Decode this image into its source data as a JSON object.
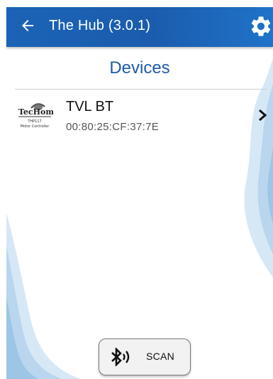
{
  "app_bar": {
    "title": "The Hub (3.0.1)",
    "back_icon": "arrow-left",
    "settings_icon": "gear",
    "color": "#1b5cad"
  },
  "main": {
    "section_title": "Devices",
    "devices": [
      {
        "name": "TVL BT",
        "mac": "00:80:25:CF:37:7E",
        "logo": {
          "brand": "TecHome",
          "model": "THP117",
          "caption": "Motor Controller"
        }
      }
    ]
  },
  "scan_button": {
    "label": "SCAN",
    "icon": "bluetooth-searching"
  },
  "colors": {
    "title_text": "#1c5ca8",
    "wave": "#b9d6ee"
  }
}
